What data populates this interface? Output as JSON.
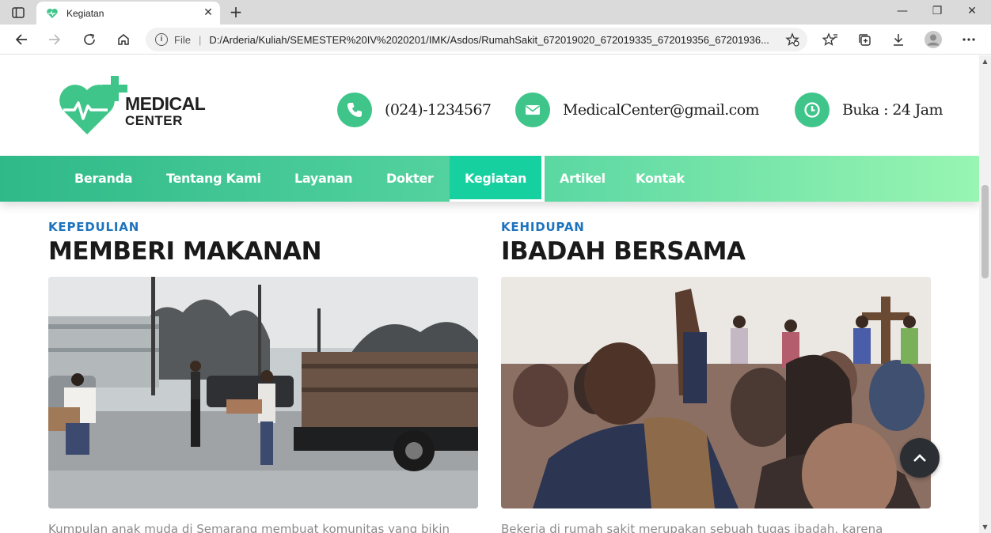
{
  "browser": {
    "tab_title": "Kegiatan",
    "address_scheme_label": "File",
    "address_url": "D:/Arderia/Kuliah/SEMESTER%20IV%2020201/IMK/Asdos/RumahSakit_672019020_672019335_672019356_67201936..."
  },
  "header": {
    "logo_line1": "MEDICAL",
    "logo_line2": "CENTER",
    "phone": "(024)-1234567",
    "email": "MedicalCenter@gmail.com",
    "hours": "Buka : 24 Jam"
  },
  "nav": {
    "items": [
      {
        "label": "Beranda"
      },
      {
        "label": "Tentang Kami"
      },
      {
        "label": "Layanan"
      },
      {
        "label": "Dokter"
      },
      {
        "label": "Kegiatan"
      },
      {
        "label": "Artikel"
      },
      {
        "label": "Kontak"
      }
    ],
    "active": "Kegiatan"
  },
  "cards": [
    {
      "category": "KEPEDULIAN",
      "title": "MEMBERI MAKANAN",
      "text": "Kumpulan anak muda di Semarang membuat komunitas yang bikin"
    },
    {
      "category": "KEHIDUPAN",
      "title": "IBADAH BERSAMA",
      "text": "Bekerja di rumah sakit merupakan sebuah tugas ibadah, karena"
    }
  ],
  "colors": {
    "brand_green": "#3fc58a",
    "nav_active": "#17d0a0",
    "category_blue": "#1e73be"
  }
}
